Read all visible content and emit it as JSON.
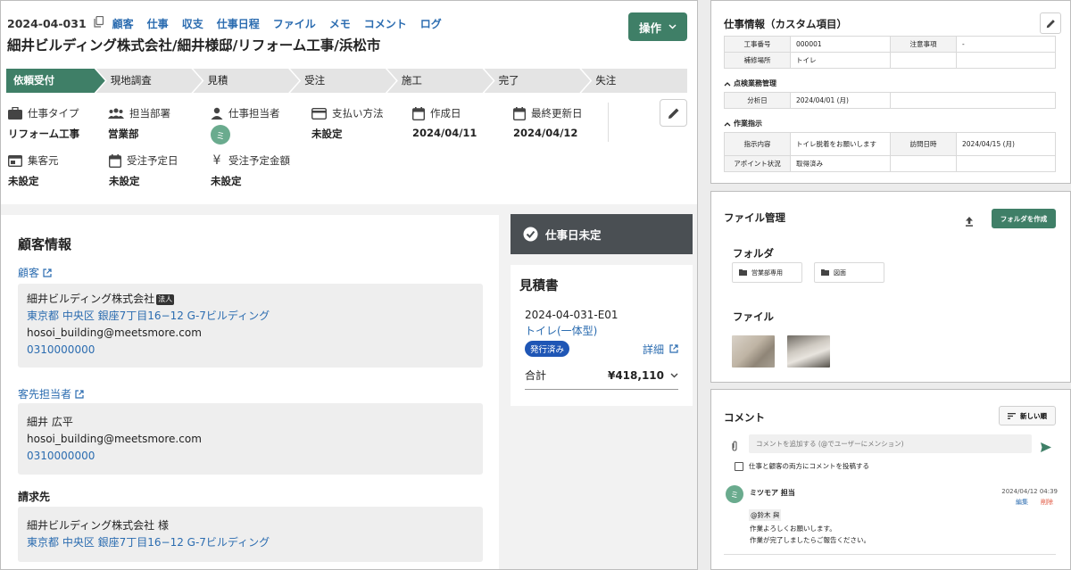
{
  "header": {
    "date": "2024-04-031",
    "nav": [
      "顧客",
      "仕事",
      "収支",
      "仕事日程",
      "ファイル",
      "メモ",
      "コメント",
      "ログ"
    ],
    "title": "細井ビルディング株式会社/細井様邸/リフォーム工事/浜松市",
    "action_label": "操作"
  },
  "steps": [
    "依頼受付",
    "現地調査",
    "見積",
    "受注",
    "施工",
    "完了",
    "失注"
  ],
  "active_step": "依頼受付",
  "fields": {
    "job_type": {
      "label": "仕事タイプ",
      "value": "リフォーム工事"
    },
    "department": {
      "label": "担当部署",
      "value": "営業部"
    },
    "staff": {
      "label": "仕事担当者",
      "avatar": "ミ"
    },
    "payment": {
      "label": "支払い方法",
      "value": "未設定"
    },
    "created": {
      "label": "作成日",
      "value": "2024/04/11"
    },
    "updated": {
      "label": "最終更新日",
      "value": "2024/04/12"
    },
    "source": {
      "label": "集客元",
      "value": "未設定"
    },
    "order_date": {
      "label": "受注予定日",
      "value": "未設定"
    },
    "order_amount": {
      "label": "受注予定金額",
      "value": "未設定"
    }
  },
  "customer": {
    "heading": "顧客情報",
    "customer_link": "顧客",
    "name": "細井ビルディング株式会社",
    "corp_tag": "法人",
    "address": "東京都 中央区 銀座7丁目16−12 G-7ビルディング",
    "email": "hosoi_building@meetsmore.com",
    "phone": "0310000000",
    "contact_link": "客先担当者",
    "contact_name": "細井 広平",
    "contact_email": "hosoi_building@meetsmore.com",
    "contact_phone": "0310000000",
    "billing_label": "請求先",
    "billing_name": "細井ビルディング株式会社 様",
    "billing_address": "東京都 中央区 銀座7丁目16−12 G-7ビルディング"
  },
  "status": {
    "label": "仕事日未定"
  },
  "quote": {
    "heading": "見積書",
    "number": "2024-04-031-E01",
    "item": "トイレ(一体型)",
    "badge": "発行済み",
    "detail": "詳細",
    "total_label": "合計",
    "total_value": "¥418,110"
  },
  "custom": {
    "heading": "仕事情報（カスタム項目）",
    "rows": [
      {
        "k1": "工事番号",
        "v1": "000001",
        "k2": "注意事項",
        "v2": "-"
      },
      {
        "k1": "補修場所",
        "v1": "トイレ",
        "k2": "",
        "v2": ""
      }
    ],
    "sec2": "点検業務管理",
    "sec2_rows": [
      {
        "k1": "分析日",
        "v1": "2024/04/01 (月)"
      }
    ],
    "sec3": "作業指示",
    "sec3_rows": [
      {
        "k1": "指示内容",
        "v1": "トイレ脱着をお願いします",
        "k2": "訪問日時",
        "v2": "2024/04/15 (月)"
      },
      {
        "k1": "アポイント状況",
        "v1": "取得済み",
        "k2": "",
        "v2": ""
      }
    ]
  },
  "files": {
    "heading": "ファイル管理",
    "new_folder": "フォルダを作成",
    "folders_heading": "フォルダ",
    "folders": [
      "営業部専用",
      "図面"
    ],
    "files_heading": "ファイル"
  },
  "comments": {
    "heading": "コメント",
    "sort_label": "新しい順",
    "placeholder": "コメントを追加する (@でユーザーにメンション)",
    "checkbox_label": "仕事と顧客の両方にコメントを投稿する",
    "items": [
      {
        "author": "ミツモア 担当",
        "avatar": "ミ",
        "time": "2024/04/12 04:39",
        "edit": "編集",
        "delete": "削除",
        "mention": "@鈴木 與",
        "line1": "作業よろしくお願いします。",
        "line2": "作業が完了しましたらご報告ください。"
      }
    ]
  },
  "colors": {
    "primary": "#3f7f67",
    "link": "#2b6cb0",
    "status_bg": "#4a4f53",
    "badge": "#1f56b5",
    "delete": "#e0533c"
  }
}
